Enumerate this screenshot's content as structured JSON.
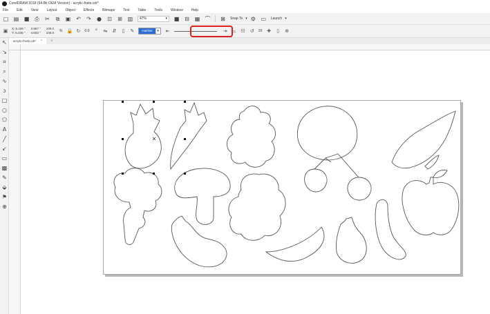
{
  "window": {
    "title": "CorelDRAW 2018 (64-Bit OEM Version) - acrylic-fruits.cdr*"
  },
  "menu": [
    "File",
    "Edit",
    "View",
    "Layout",
    "Object",
    "Effects",
    "Bitmaps",
    "Text",
    "Table",
    "Tools",
    "Window",
    "Help"
  ],
  "toolbar": {
    "zoom_value": "47%",
    "snap_label": "Snap To",
    "launch_label": "Launch"
  },
  "propbar": {
    "x": "X: 5.426 \"",
    "y": "Y: 6.236 \"",
    "w": "3.967 \"",
    "h": "4.603 \"",
    "scale_w": "100.0",
    "scale_h": "100.0",
    "pct": "%",
    "angle": "0.0",
    "outline_width": "Hairline",
    "size_value": "10"
  },
  "document": {
    "tab_label": "acrylic-fruits.cdr*"
  },
  "colors": {
    "highlight": "#e01f1f",
    "selection_blue": "#2b6fd6"
  },
  "icons": [
    "new-icon",
    "open-icon",
    "save-icon",
    "print-icon",
    "cut-icon",
    "copy-icon",
    "paste-icon",
    "undo-icon",
    "redo-icon",
    "pick-tool-icon",
    "shape-tool-icon",
    "crop-tool-icon",
    "zoom-tool-icon",
    "freehand-tool-icon",
    "rectangle-tool-icon",
    "ellipse-tool-icon",
    "polygon-tool-icon",
    "text-tool-icon",
    "line-tool-icon",
    "connector-tool-icon",
    "shadow-tool-icon",
    "transparency-tool-icon",
    "eyedropper-tool-icon",
    "fill-tool-icon",
    "outline-tool-icon",
    "add-tool-icon"
  ]
}
